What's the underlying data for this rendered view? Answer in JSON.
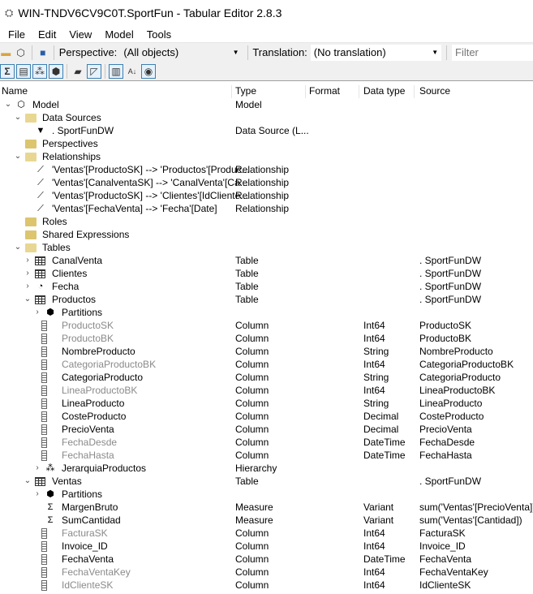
{
  "window": {
    "title": "WIN-TNDV6CV9C0T.SportFun - Tabular Editor 2.8.3"
  },
  "menu": [
    "File",
    "Edit",
    "View",
    "Model",
    "Tools"
  ],
  "toolbar": {
    "perspective_label": "Perspective:",
    "perspective_value": "(All objects)",
    "translation_label": "Translation:",
    "translation_value": "(No translation)",
    "filter_placeholder": "Filter"
  },
  "columns": [
    "Name",
    "Type",
    "Format",
    "Data type",
    "Source"
  ],
  "rows": [
    {
      "level": 0,
      "exp": "open",
      "icon": "model",
      "name": "Model",
      "type": "Model"
    },
    {
      "level": 1,
      "exp": "open",
      "icon": "folder-open",
      "name": "Data Sources"
    },
    {
      "level": 2,
      "icon": "datasource",
      "name": ". SportFunDW",
      "type": "Data Source (L..."
    },
    {
      "level": 1,
      "icon": "folder",
      "name": "Perspectives"
    },
    {
      "level": 1,
      "exp": "open",
      "icon": "folder-open",
      "name": "Relationships"
    },
    {
      "level": 2,
      "icon": "relationship",
      "name": "'Ventas'[ProductoSK] --> 'Productos'[Produc...",
      "type": "Relationship"
    },
    {
      "level": 2,
      "icon": "relationship",
      "name": "'Ventas'[CanalventaSK] --> 'CanalVenta'[Ca...",
      "type": "Relationship"
    },
    {
      "level": 2,
      "icon": "relationship",
      "name": "'Ventas'[ProductoSK] --> 'Clientes'[IdCliente...",
      "type": "Relationship"
    },
    {
      "level": 2,
      "icon": "relationship",
      "name": "'Ventas'[FechaVenta] --> 'Fecha'[Date]",
      "type": "Relationship"
    },
    {
      "level": 1,
      "icon": "folder",
      "name": "Roles"
    },
    {
      "level": 1,
      "icon": "folder",
      "name": "Shared Expressions"
    },
    {
      "level": 1,
      "exp": "open",
      "icon": "folder-open",
      "name": "Tables"
    },
    {
      "level": 2,
      "exp": "closed",
      "icon": "table",
      "name": "CanalVenta",
      "type": "Table",
      "source": ". SportFunDW"
    },
    {
      "level": 2,
      "exp": "closed",
      "icon": "table",
      "name": "Clientes",
      "type": "Table",
      "source": ". SportFunDW"
    },
    {
      "level": 2,
      "exp": "closed",
      "icon": "date-table",
      "name": "Fecha",
      "type": "Table",
      "source": ". SportFunDW"
    },
    {
      "level": 2,
      "exp": "open",
      "icon": "table",
      "name": "Productos",
      "type": "Table",
      "source": ". SportFunDW"
    },
    {
      "level": 3,
      "exp": "closed",
      "icon": "partitions",
      "name": "Partitions"
    },
    {
      "level": 3,
      "icon": "column",
      "name": "ProductoSK",
      "type": "Column",
      "datatype": "Int64",
      "source": "ProductoSK",
      "hidden": true
    },
    {
      "level": 3,
      "icon": "column",
      "name": "ProductoBK",
      "type": "Column",
      "datatype": "Int64",
      "source": "ProductoBK",
      "hidden": true
    },
    {
      "level": 3,
      "icon": "column",
      "name": "NombreProducto",
      "type": "Column",
      "datatype": "String",
      "source": "NombreProducto"
    },
    {
      "level": 3,
      "icon": "column",
      "name": "CategoriaProductoBK",
      "type": "Column",
      "datatype": "Int64",
      "source": "CategoriaProductoBK",
      "hidden": true
    },
    {
      "level": 3,
      "icon": "column",
      "name": "CategoriaProducto",
      "type": "Column",
      "datatype": "String",
      "source": "CategoriaProducto"
    },
    {
      "level": 3,
      "icon": "column",
      "name": "LineaProductoBK",
      "type": "Column",
      "datatype": "Int64",
      "source": "LineaProductoBK",
      "hidden": true
    },
    {
      "level": 3,
      "icon": "column",
      "name": "LineaProducto",
      "type": "Column",
      "datatype": "String",
      "source": "LineaProducto"
    },
    {
      "level": 3,
      "icon": "column",
      "name": "CosteProducto",
      "type": "Column",
      "datatype": "Decimal",
      "source": "CosteProducto"
    },
    {
      "level": 3,
      "icon": "column",
      "name": "PrecioVenta",
      "type": "Column",
      "datatype": "Decimal",
      "source": "PrecioVenta"
    },
    {
      "level": 3,
      "icon": "column",
      "name": "FechaDesde",
      "type": "Column",
      "datatype": "DateTime",
      "source": "FechaDesde",
      "hidden": true
    },
    {
      "level": 3,
      "icon": "column",
      "name": "FechaHasta",
      "type": "Column",
      "datatype": "DateTime",
      "source": "FechaHasta",
      "hidden": true
    },
    {
      "level": 3,
      "exp": "closed",
      "icon": "hierarchy",
      "name": "JerarquiaProductos",
      "type": "Hierarchy"
    },
    {
      "level": 2,
      "exp": "open",
      "icon": "table",
      "name": "Ventas",
      "type": "Table",
      "source": ". SportFunDW"
    },
    {
      "level": 3,
      "exp": "closed",
      "icon": "partitions",
      "name": "Partitions"
    },
    {
      "level": 3,
      "icon": "measure",
      "name": "MargenBruto",
      "type": "Measure",
      "datatype": "Variant",
      "source": "sum('Ventas'[PrecioVenta])"
    },
    {
      "level": 3,
      "icon": "measure",
      "name": "SumCantidad",
      "type": "Measure",
      "datatype": "Variant",
      "source": "sum('Ventas'[Cantidad])"
    },
    {
      "level": 3,
      "icon": "column",
      "name": "FacturaSK",
      "type": "Column",
      "datatype": "Int64",
      "source": "FacturaSK",
      "hidden": true
    },
    {
      "level": 3,
      "icon": "column",
      "name": "Invoice_ID",
      "type": "Column",
      "datatype": "Int64",
      "source": "Invoice_ID"
    },
    {
      "level": 3,
      "icon": "column",
      "name": "FechaVenta",
      "type": "Column",
      "datatype": "DateTime",
      "source": "FechaVenta"
    },
    {
      "level": 3,
      "icon": "column",
      "name": "FechaVentaKey",
      "type": "Column",
      "datatype": "Int64",
      "source": "FechaVentaKey",
      "hidden": true
    },
    {
      "level": 3,
      "icon": "column",
      "name": "IdClienteSK",
      "type": "Column",
      "datatype": "Int64",
      "source": "IdClienteSK",
      "hidden": true
    }
  ]
}
